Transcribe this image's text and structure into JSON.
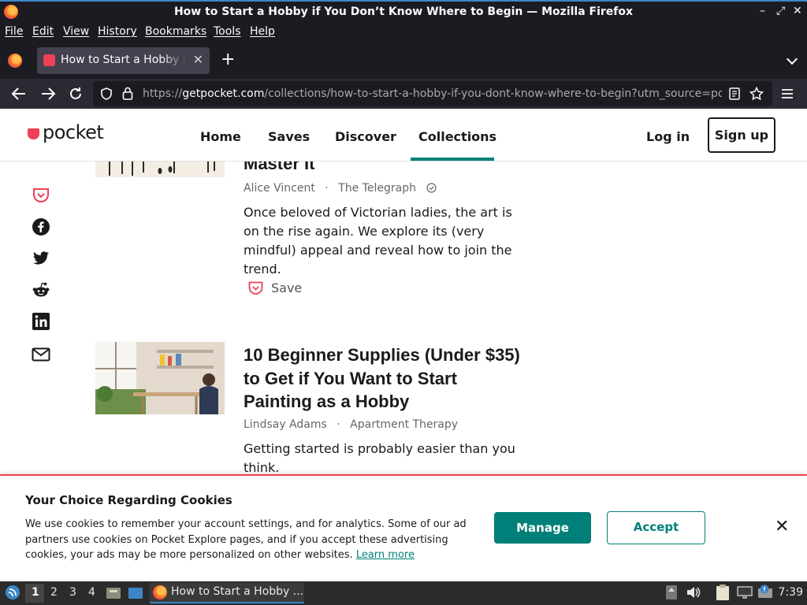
{
  "window": {
    "title": "How to Start a Hobby if You Don’t Know Where to Begin — Mozilla Firefox",
    "controls": [
      "–",
      "⤢",
      "✕"
    ]
  },
  "menu": [
    "File",
    "Edit",
    "View",
    "History",
    "Bookmarks",
    "Tools",
    "Help"
  ],
  "tab": {
    "title": "How to Start a Hobby if You Don’t Know Where to Begin",
    "close": "✕",
    "new_tab": "+"
  },
  "nav": {
    "url_prefix": "https://",
    "url_host": "getpocket.com",
    "url_rest": "/collections/how-to-start-a-hobby-if-you-dont-know-where-to-begin?utm_source=pocket"
  },
  "site": {
    "logo_text": "pocket",
    "nav": [
      "Home",
      "Saves",
      "Discover",
      "Collections"
    ],
    "active_nav": "Collections",
    "login": "Log in",
    "signup": "Sign up"
  },
  "share_icons": [
    "pocket-icon",
    "facebook-icon",
    "twitter-icon",
    "reddit-icon",
    "linkedin-icon",
    "email-icon"
  ],
  "articles": [
    {
      "title": "Master It",
      "author": "Alice Vincent",
      "sep": "·",
      "publisher": "The Telegraph",
      "excerpt": "Once beloved of Victorian ladies, the art is on the rise again. We explore its (very mindful) appeal and reveal how to join the trend.",
      "save_label": "Save"
    },
    {
      "title": "10 Beginner Supplies (Under $35) to Get if You Want to Start Painting as a Hobby",
      "author": "Lindsay Adams",
      "sep": "·",
      "publisher": "Apartment Therapy",
      "excerpt": "Getting started is probably easier than you think."
    }
  ],
  "cookie": {
    "heading": "Your Choice Regarding Cookies",
    "body": "We use cookies to remember your account settings, and for analytics. Some of our ad partners use cookies on Pocket Explore pages, and if you accept these advertising cookies, your ads may be more personalized on other websites. ",
    "link": "Learn more",
    "manage": "Manage",
    "accept": "Accept",
    "close": "✕"
  },
  "taskbar": {
    "workspaces": [
      "1",
      "2",
      "3",
      "4"
    ],
    "window_label": "How to Start a Hobby ...",
    "clock": "7:39"
  },
  "colors": {
    "accent": "#008078",
    "pocket_red": "#EF4056",
    "chrome_dark": "#1C1B22"
  }
}
